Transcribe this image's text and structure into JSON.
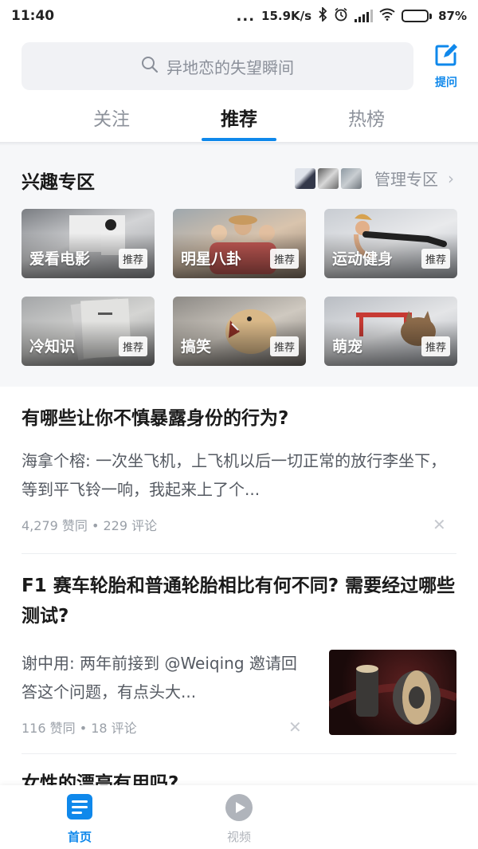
{
  "status_bar": {
    "time": "11:40",
    "signal_dots": "...",
    "network_speed": "15.9K/s",
    "battery_percent": "87%",
    "battery_level": 0.87
  },
  "header": {
    "search_placeholder": "异地恋的失望瞬间",
    "ask_label": "提问",
    "accent_color": "#0f88eb"
  },
  "tabs": [
    {
      "label": "关注",
      "active": false
    },
    {
      "label": "推荐",
      "active": true
    },
    {
      "label": "热榜",
      "active": false
    }
  ],
  "interest": {
    "title": "兴趣专区",
    "manage_label": "管理专区",
    "cards": [
      {
        "name": "爱看电影",
        "badge": "推荐"
      },
      {
        "name": "明星八卦",
        "badge": "推荐"
      },
      {
        "name": "运动健身",
        "badge": "推荐"
      },
      {
        "name": "冷知识",
        "badge": "推荐"
      },
      {
        "name": "搞笑",
        "badge": "推荐"
      },
      {
        "name": "萌宠",
        "badge": "推荐"
      }
    ]
  },
  "feed": [
    {
      "title": "有哪些让你不慎暴露身份的行为?",
      "excerpt": "海拿个榕: 一次坐飞机，上飞机以后一切正常的放行李坐下，等到平飞铃一响，我起来上了个...",
      "meta": "4,279 赞同 • 229 评论"
    },
    {
      "title": "F1 赛车轮胎和普通轮胎相比有何不同? 需要经过哪些测试?",
      "excerpt": "谢中用: 两年前接到 @Weiqing 邀请回答这个问题，有点头大...",
      "meta": "116 赞同 • 18 评论"
    },
    {
      "title": "女性的漂亮有用吗?"
    }
  ],
  "bottom_nav": [
    {
      "label": "首页",
      "active": true
    },
    {
      "label": "视频",
      "active": false
    }
  ]
}
